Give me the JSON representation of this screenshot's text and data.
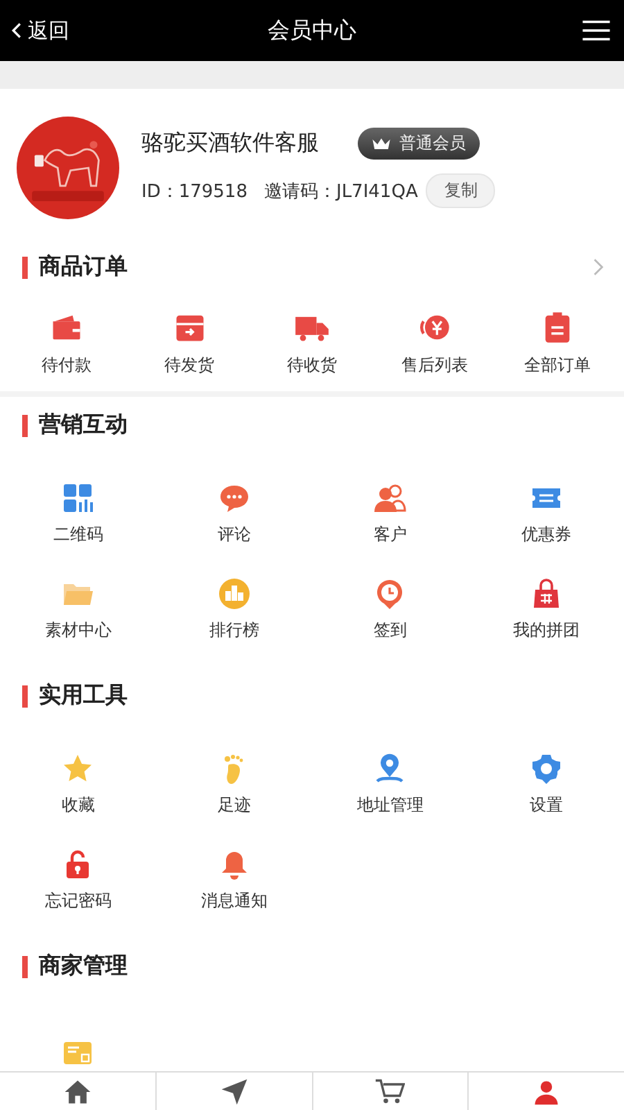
{
  "header": {
    "back": "返回",
    "title": "会员中心"
  },
  "profile": {
    "name": "骆驼买酒软件客服",
    "badge": "普通会员",
    "id": "ID：179518",
    "invite": "邀请码：JL7I41QA",
    "copy": "复制"
  },
  "orders": {
    "title": "商品订单",
    "items": [
      {
        "label": "待付款"
      },
      {
        "label": "待发货"
      },
      {
        "label": "待收货"
      },
      {
        "label": "售后列表"
      },
      {
        "label": "全部订单"
      }
    ]
  },
  "marketing": {
    "title": "营销互动",
    "items": [
      {
        "label": "二维码"
      },
      {
        "label": "评论"
      },
      {
        "label": "客户"
      },
      {
        "label": "优惠券"
      },
      {
        "label": "素材中心"
      },
      {
        "label": "排行榜"
      },
      {
        "label": "签到"
      },
      {
        "label": "我的拼团"
      }
    ]
  },
  "tools": {
    "title": "实用工具",
    "items": [
      {
        "label": "收藏"
      },
      {
        "label": "足迹"
      },
      {
        "label": "地址管理"
      },
      {
        "label": "设置"
      },
      {
        "label": "忘记密码"
      },
      {
        "label": "消息通知"
      }
    ]
  },
  "merchant": {
    "title": "商家管理"
  },
  "tabbar": [
    {
      "selected": false
    },
    {
      "selected": false
    },
    {
      "selected": false
    },
    {
      "selected": true
    }
  ]
}
